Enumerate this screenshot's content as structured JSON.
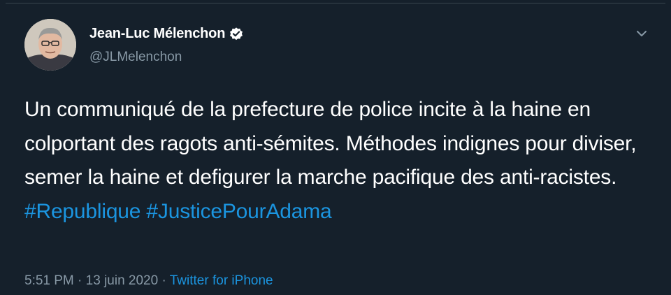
{
  "tweet": {
    "author": {
      "name": "Jean-Luc Mélenchon",
      "handle": "@JLMelenchon",
      "verified": true
    },
    "text": "Un communiqué de la prefecture de police incite à la haine en colportant des ragots anti-sémites. Méthodes indignes pour diviser, semer la haine et defigurer la marche pacifique des anti-racistes.",
    "hashtags": [
      "#Republique",
      "#JusticePourAdama"
    ],
    "time": "5:51 PM",
    "separator": "·",
    "date": "13 juin 2020",
    "source": "Twitter for iPhone"
  },
  "colors": {
    "background": "#15202b",
    "text": "#ffffff",
    "secondary_text": "#8899a6",
    "link": "#1b95e0",
    "verified_badge": "#ffffff"
  },
  "icons": {
    "verified": "verified-badge-icon",
    "menu": "chevron-down-icon"
  }
}
